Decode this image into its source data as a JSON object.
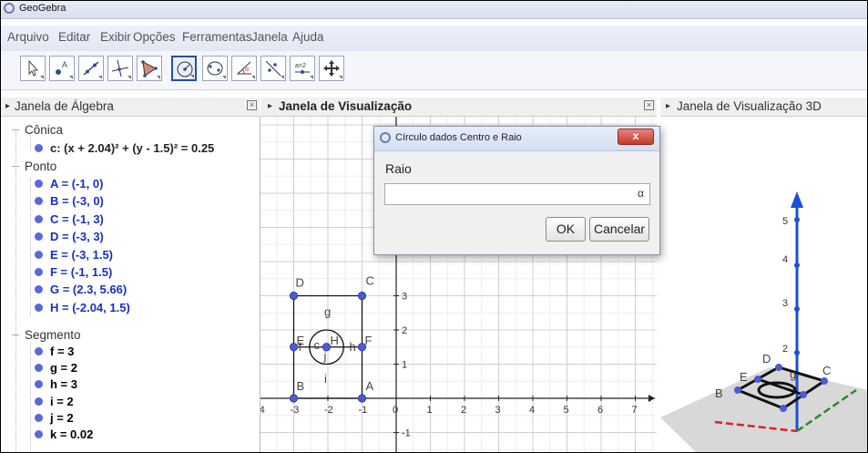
{
  "window": {
    "title": "GeoGebra"
  },
  "menu": [
    "Arquivo",
    "Editar",
    "Exibir",
    "Opções",
    "Ferramentas",
    "Janela",
    "Ajuda"
  ],
  "toolbar": {
    "tools": [
      "move-tool",
      "point-tool",
      "line-tool",
      "perpendicular-tool",
      "polygon-tool",
      "circle-center-radius-tool",
      "conic-tool",
      "angle-tool",
      "reflect-tool",
      "slider-tool",
      "move-view-tool"
    ],
    "selected": "circle-center-radius-tool",
    "slider_label": "a=2"
  },
  "panels": {
    "algebra": {
      "title": "Janela de Álgebra"
    },
    "graphics": {
      "title": "Janela de Visualização"
    },
    "graphics3d": {
      "title": "Janela de Visualização 3D"
    }
  },
  "algebra": {
    "conica": {
      "category": "Cônica",
      "items": [
        {
          "text": "c: (x + 2.04)² + (y - 1.5)² = 0.25",
          "color": "#000000"
        }
      ]
    },
    "ponto": {
      "category": "Ponto",
      "items": [
        {
          "text": "A = (-1, 0)",
          "color": "#1a2fbf"
        },
        {
          "text": "B = (-3, 0)",
          "color": "#1a2fbf"
        },
        {
          "text": "C = (-1, 3)",
          "color": "#1a2fbf"
        },
        {
          "text": "D = (-3, 3)",
          "color": "#1a2fbf"
        },
        {
          "text": "E = (-3, 1.5)",
          "color": "#1a2fbf"
        },
        {
          "text": "F = (-1, 1.5)",
          "color": "#1a2fbf"
        },
        {
          "text": "G = (2.3, 5.66)",
          "color": "#1a2fbf"
        },
        {
          "text": "H = (-2.04, 1.5)",
          "color": "#1a2fbf"
        }
      ]
    },
    "segmento": {
      "category": "Segmento",
      "items": [
        {
          "text": "f = 3",
          "color": "#000000"
        },
        {
          "text": "g = 2",
          "color": "#000000"
        },
        {
          "text": "h = 3",
          "color": "#000000"
        },
        {
          "text": "i = 2",
          "color": "#000000"
        },
        {
          "text": "j = 2",
          "color": "#000000"
        },
        {
          "text": "k = 0.02",
          "color": "#000000"
        }
      ]
    }
  },
  "dialog": {
    "title": "Círculo dados Centro e Raio",
    "label": "Raio",
    "input_value": "",
    "alpha_symbol": "α",
    "ok_label": "OK",
    "cancel_label": "Cancelar",
    "close_symbol": "x"
  },
  "graphics": {
    "x_ticks": [
      "-4",
      "-3",
      "-2",
      "-1",
      "0",
      "1",
      "2",
      "3",
      "4",
      "5",
      "6",
      "7"
    ],
    "y_ticks": [
      "3",
      "2",
      "1",
      "-1"
    ],
    "point_labels": [
      "A",
      "B",
      "C",
      "D",
      "E",
      "F",
      "H"
    ],
    "segment_labels": [
      "f",
      "g",
      "h",
      "i",
      "j",
      "c"
    ],
    "point_color": "#4a5bd4"
  },
  "graphics3d": {
    "z_ticks": [
      "5",
      "4",
      "3",
      "2"
    ],
    "labels": [
      "B",
      "D",
      "C",
      "E",
      "g"
    ]
  },
  "colors": {
    "accent": "#2a4f9b",
    "point": "#1a2fbf",
    "axis_blue": "#1a4fd6",
    "axis_red": "#d22",
    "axis_green": "#2a8a2a"
  }
}
